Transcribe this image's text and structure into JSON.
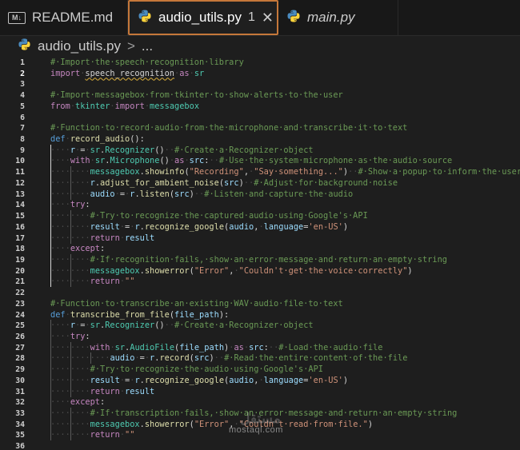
{
  "tabs": [
    {
      "icon": "markdown-icon",
      "icon_text": "M↓",
      "label": "README.md",
      "italic": false
    },
    {
      "icon": "python-icon",
      "label": "audio_utils.py",
      "badge": "1",
      "close": "✕",
      "italic": false
    },
    {
      "icon": "python-icon",
      "label": "main.py",
      "italic": true
    }
  ],
  "breadcrumb": {
    "file": "audio_utils.py",
    "separator": ">",
    "more": "..."
  },
  "colors": {
    "editor_bg": "#1e1e1e",
    "comment": "#6a9955",
    "keyword": "#569cd6",
    "import_keyword": "#c586c0",
    "function": "#dcdcaa",
    "variable": "#9cdcfe",
    "string": "#ce9178",
    "class": "#4ec9b0",
    "active_tab_border": "#c5773a"
  },
  "current_line": 2,
  "lines": [
    {
      "n": 1,
      "indent": 0,
      "tokens": [
        [
          "c",
          "#·Import·the·speech·recognition·library"
        ]
      ]
    },
    {
      "n": 2,
      "indent": 0,
      "tokens": [
        [
          "kc",
          "import"
        ],
        [
          "ind",
          "·"
        ],
        [
          "wav",
          "speech_recognition"
        ],
        [
          "ind",
          "·"
        ],
        [
          "kc",
          "as"
        ],
        [
          "ind",
          "·"
        ],
        [
          "t",
          "sr"
        ]
      ]
    },
    {
      "n": 3,
      "indent": 0,
      "tokens": []
    },
    {
      "n": 4,
      "indent": 0,
      "tokens": [
        [
          "c",
          "#·Import·messagebox·from·tkinter·to·show·alerts·to·the·user"
        ]
      ]
    },
    {
      "n": 5,
      "indent": 0,
      "tokens": [
        [
          "kc",
          "from"
        ],
        [
          "ind",
          "·"
        ],
        [
          "t",
          "tkinter"
        ],
        [
          "ind",
          "·"
        ],
        [
          "kc",
          "import"
        ],
        [
          "ind",
          "·"
        ],
        [
          "t",
          "messagebox"
        ]
      ]
    },
    {
      "n": 6,
      "indent": 0,
      "tokens": []
    },
    {
      "n": 7,
      "indent": 0,
      "tokens": [
        [
          "c",
          "#·Function·to·record·audio·from·the·microphone·and·transcribe·it·to·text"
        ]
      ]
    },
    {
      "n": 8,
      "indent": 0,
      "tokens": [
        [
          "k",
          "def"
        ],
        [
          "ind",
          "·"
        ],
        [
          "f",
          "record_audio"
        ],
        [
          "d",
          "():"
        ]
      ]
    },
    {
      "n": 9,
      "indent": 1,
      "tokens": [
        [
          "v",
          "r"
        ],
        [
          "ind",
          "·"
        ],
        [
          "d",
          "="
        ],
        [
          "ind",
          "·"
        ],
        [
          "t",
          "sr"
        ],
        [
          "d",
          "."
        ],
        [
          "t",
          "Recognizer"
        ],
        [
          "d",
          "()"
        ],
        [
          "ind",
          "··"
        ],
        [
          "c",
          "#·Create·a·Recognizer·object"
        ]
      ]
    },
    {
      "n": 10,
      "indent": 1,
      "tokens": [
        [
          "kc",
          "with"
        ],
        [
          "ind",
          "·"
        ],
        [
          "t",
          "sr"
        ],
        [
          "d",
          "."
        ],
        [
          "t",
          "Microphone"
        ],
        [
          "d",
          "()"
        ],
        [
          "ind",
          "·"
        ],
        [
          "kc",
          "as"
        ],
        [
          "ind",
          "·"
        ],
        [
          "v",
          "src"
        ],
        [
          "d",
          ":"
        ],
        [
          "ind",
          "··"
        ],
        [
          "c",
          "#·Use·the·system·microphone·as·the·audio·source"
        ]
      ]
    },
    {
      "n": 11,
      "indent": 2,
      "tokens": [
        [
          "t",
          "messagebox"
        ],
        [
          "d",
          "."
        ],
        [
          "f",
          "showinfo"
        ],
        [
          "d",
          "("
        ],
        [
          "s",
          "\"Recording\""
        ],
        [
          "d",
          ","
        ],
        [
          "ind",
          "·"
        ],
        [
          "s",
          "\"Say·something...\""
        ],
        [
          "d",
          ")"
        ],
        [
          "ind",
          "··"
        ],
        [
          "c",
          "#·Show·a·popup·to·inform·the·user"
        ]
      ]
    },
    {
      "n": 12,
      "indent": 2,
      "tokens": [
        [
          "v",
          "r"
        ],
        [
          "d",
          "."
        ],
        [
          "f",
          "adjust_for_ambient_noise"
        ],
        [
          "d",
          "("
        ],
        [
          "v",
          "src"
        ],
        [
          "d",
          ")"
        ],
        [
          "ind",
          "··"
        ],
        [
          "c",
          "#·Adjust·for·background·noise"
        ]
      ]
    },
    {
      "n": 13,
      "indent": 2,
      "tokens": [
        [
          "v",
          "audio"
        ],
        [
          "ind",
          "·"
        ],
        [
          "d",
          "="
        ],
        [
          "ind",
          "·"
        ],
        [
          "v",
          "r"
        ],
        [
          "d",
          "."
        ],
        [
          "f",
          "listen"
        ],
        [
          "d",
          "("
        ],
        [
          "v",
          "src"
        ],
        [
          "d",
          ")"
        ],
        [
          "ind",
          "··"
        ],
        [
          "c",
          "#·Listen·and·capture·the·audio"
        ]
      ]
    },
    {
      "n": 14,
      "indent": 1,
      "tokens": [
        [
          "kc",
          "try"
        ],
        [
          "d",
          ":"
        ]
      ]
    },
    {
      "n": 15,
      "indent": 2,
      "tokens": [
        [
          "c",
          "#·Try·to·recognize·the·captured·audio·using·Google's·API"
        ]
      ]
    },
    {
      "n": 16,
      "indent": 2,
      "tokens": [
        [
          "v",
          "result"
        ],
        [
          "ind",
          "·"
        ],
        [
          "d",
          "="
        ],
        [
          "ind",
          "·"
        ],
        [
          "v",
          "r"
        ],
        [
          "d",
          "."
        ],
        [
          "f",
          "recognize_google"
        ],
        [
          "d",
          "("
        ],
        [
          "v",
          "audio"
        ],
        [
          "d",
          ","
        ],
        [
          "ind",
          "·"
        ],
        [
          "v",
          "language"
        ],
        [
          "d",
          "="
        ],
        [
          "s",
          "'en-US'"
        ],
        [
          "d",
          ")"
        ]
      ]
    },
    {
      "n": 17,
      "indent": 2,
      "tokens": [
        [
          "kc",
          "return"
        ],
        [
          "ind",
          "·"
        ],
        [
          "v",
          "result"
        ]
      ]
    },
    {
      "n": 18,
      "indent": 1,
      "tokens": [
        [
          "kc",
          "except"
        ],
        [
          "d",
          ":"
        ]
      ]
    },
    {
      "n": 19,
      "indent": 2,
      "tokens": [
        [
          "c",
          "#·If·recognition·fails,·show·an·error·message·and·return·an·empty·string"
        ]
      ]
    },
    {
      "n": 20,
      "indent": 2,
      "tokens": [
        [
          "t",
          "messagebox"
        ],
        [
          "d",
          "."
        ],
        [
          "f",
          "showerror"
        ],
        [
          "d",
          "("
        ],
        [
          "s",
          "\"Error\""
        ],
        [
          "d",
          ","
        ],
        [
          "ind",
          "·"
        ],
        [
          "s",
          "\"Couldn't·get·the·voice·correctly\""
        ],
        [
          "d",
          ")"
        ]
      ]
    },
    {
      "n": 21,
      "indent": 2,
      "tokens": [
        [
          "kc",
          "return"
        ],
        [
          "ind",
          "·"
        ],
        [
          "s",
          "\"\""
        ]
      ]
    },
    {
      "n": 22,
      "indent": 0,
      "tokens": []
    },
    {
      "n": 23,
      "indent": 0,
      "tokens": [
        [
          "c",
          "#·Function·to·transcribe·an·existing·WAV·audio·file·to·text"
        ]
      ]
    },
    {
      "n": 24,
      "indent": 0,
      "tokens": [
        [
          "k",
          "def"
        ],
        [
          "ind",
          "·"
        ],
        [
          "f",
          "transcribe_from_file"
        ],
        [
          "d",
          "("
        ],
        [
          "v",
          "file_path"
        ],
        [
          "d",
          "):"
        ]
      ]
    },
    {
      "n": 25,
      "indent": 1,
      "tokens": [
        [
          "v",
          "r"
        ],
        [
          "ind",
          "·"
        ],
        [
          "d",
          "="
        ],
        [
          "ind",
          "·"
        ],
        [
          "t",
          "sr"
        ],
        [
          "d",
          "."
        ],
        [
          "t",
          "Recognizer"
        ],
        [
          "d",
          "()"
        ],
        [
          "ind",
          "··"
        ],
        [
          "c",
          "#·Create·a·Recognizer·object"
        ]
      ]
    },
    {
      "n": 26,
      "indent": 1,
      "tokens": [
        [
          "kc",
          "try"
        ],
        [
          "d",
          ":"
        ]
      ]
    },
    {
      "n": 27,
      "indent": 2,
      "tokens": [
        [
          "kc",
          "with"
        ],
        [
          "ind",
          "·"
        ],
        [
          "t",
          "sr"
        ],
        [
          "d",
          "."
        ],
        [
          "t",
          "AudioFile"
        ],
        [
          "d",
          "("
        ],
        [
          "v",
          "file_path"
        ],
        [
          "d",
          ")"
        ],
        [
          "ind",
          "·"
        ],
        [
          "kc",
          "as"
        ],
        [
          "ind",
          "·"
        ],
        [
          "v",
          "src"
        ],
        [
          "d",
          ":"
        ],
        [
          "ind",
          "··"
        ],
        [
          "c",
          "#·Load·the·audio·file"
        ]
      ]
    },
    {
      "n": 28,
      "indent": 3,
      "tokens": [
        [
          "v",
          "audio"
        ],
        [
          "ind",
          "·"
        ],
        [
          "d",
          "="
        ],
        [
          "ind",
          "·"
        ],
        [
          "v",
          "r"
        ],
        [
          "d",
          "."
        ],
        [
          "f",
          "record"
        ],
        [
          "d",
          "("
        ],
        [
          "v",
          "src"
        ],
        [
          "d",
          ")"
        ],
        [
          "ind",
          "··"
        ],
        [
          "c",
          "#·Read·the·entire·content·of·the·file"
        ]
      ]
    },
    {
      "n": 29,
      "indent": 2,
      "tokens": [
        [
          "c",
          "#·Try·to·recognize·the·audio·using·Google's·API"
        ]
      ]
    },
    {
      "n": 30,
      "indent": 2,
      "tokens": [
        [
          "v",
          "result"
        ],
        [
          "ind",
          "·"
        ],
        [
          "d",
          "="
        ],
        [
          "ind",
          "·"
        ],
        [
          "v",
          "r"
        ],
        [
          "d",
          "."
        ],
        [
          "f",
          "recognize_google"
        ],
        [
          "d",
          "("
        ],
        [
          "v",
          "audio"
        ],
        [
          "d",
          ","
        ],
        [
          "ind",
          "·"
        ],
        [
          "v",
          "language"
        ],
        [
          "d",
          "="
        ],
        [
          "s",
          "'en-US'"
        ],
        [
          "d",
          ")"
        ]
      ]
    },
    {
      "n": 31,
      "indent": 2,
      "tokens": [
        [
          "kc",
          "return"
        ],
        [
          "ind",
          "·"
        ],
        [
          "v",
          "result"
        ]
      ]
    },
    {
      "n": 32,
      "indent": 1,
      "tokens": [
        [
          "kc",
          "except"
        ],
        [
          "d",
          ":"
        ]
      ]
    },
    {
      "n": 33,
      "indent": 2,
      "tokens": [
        [
          "c",
          "#·If·transcription·fails,·show·an·error·message·and·return·an·empty·string"
        ]
      ]
    },
    {
      "n": 34,
      "indent": 2,
      "tokens": [
        [
          "t",
          "messagebox"
        ],
        [
          "d",
          "."
        ],
        [
          "f",
          "showerror"
        ],
        [
          "d",
          "("
        ],
        [
          "s",
          "\"Error\""
        ],
        [
          "d",
          ","
        ],
        [
          "ind",
          "·"
        ],
        [
          "s",
          "\"Couldn't·read·from·file.\""
        ],
        [
          "d",
          ")"
        ]
      ]
    },
    {
      "n": 35,
      "indent": 2,
      "tokens": [
        [
          "kc",
          "return"
        ],
        [
          "ind",
          "·"
        ],
        [
          "s",
          "\"\""
        ]
      ]
    },
    {
      "n": 36,
      "indent": 0,
      "tokens": []
    }
  ],
  "watermark": {
    "logo_text": "مستقل",
    "site": "mostaql.com"
  }
}
